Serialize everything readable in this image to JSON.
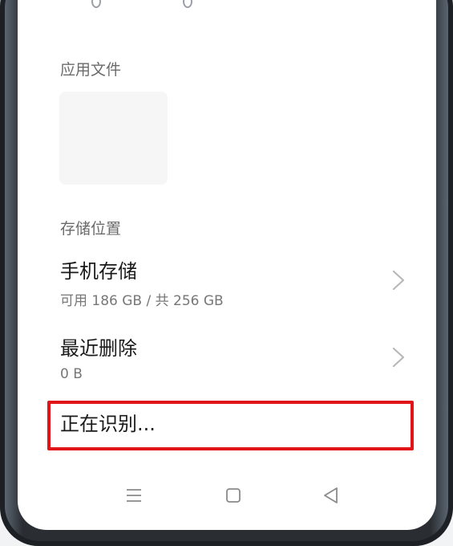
{
  "sections": {
    "app_files_label": "应用文件",
    "storage_location_label": "存储位置"
  },
  "storage_rows": [
    {
      "title": "手机存储",
      "subtitle": "可用 186 GB / 共 256 GB"
    },
    {
      "title": "最近删除",
      "subtitle": "0 B"
    }
  ],
  "status": {
    "recognizing": "正在识别..."
  },
  "colors": {
    "highlight": "#e1141a",
    "background": "#ffffff",
    "primary_text": "#1a1a1a",
    "secondary_text": "#777777"
  },
  "icons": {
    "chevron": "chevron-right-icon",
    "nav_menu": "menu-icon",
    "nav_home": "home-icon",
    "nav_back": "back-icon"
  }
}
